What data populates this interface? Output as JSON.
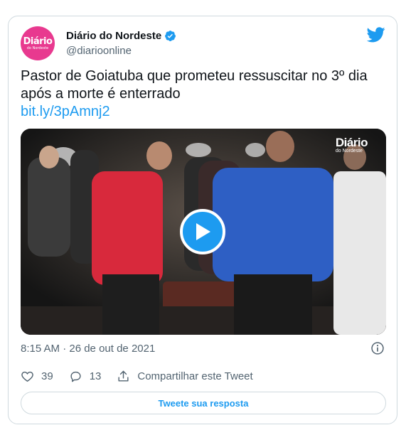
{
  "account": {
    "display_name": "Diário do Nordeste",
    "handle": "@diarioonline",
    "avatar_text": "Diário",
    "avatar_subtext": "do Nordeste",
    "verified_color": "#1d9bf0"
  },
  "tweet": {
    "text_line1": "Pastor de Goiatuba que prometeu ressuscitar no 3º dia",
    "text_line2": "após a morte é enterrado",
    "link": "bit.ly/3pAmnj2",
    "timestamp": "8:15 AM · 26 de out de 2021"
  },
  "media": {
    "watermark_title": "Diário",
    "watermark_subtitle": "do Nordeste",
    "play_icon": "play-icon"
  },
  "actions": {
    "likes": "39",
    "replies": "13",
    "share_label": "Compartilhar este Tweet"
  },
  "reply_button": {
    "label": "Tweete sua resposta"
  },
  "colors": {
    "accent": "#1d9bf0",
    "brand_pink": "#e8398f",
    "text_secondary": "#536471",
    "border": "#cfd9de"
  }
}
